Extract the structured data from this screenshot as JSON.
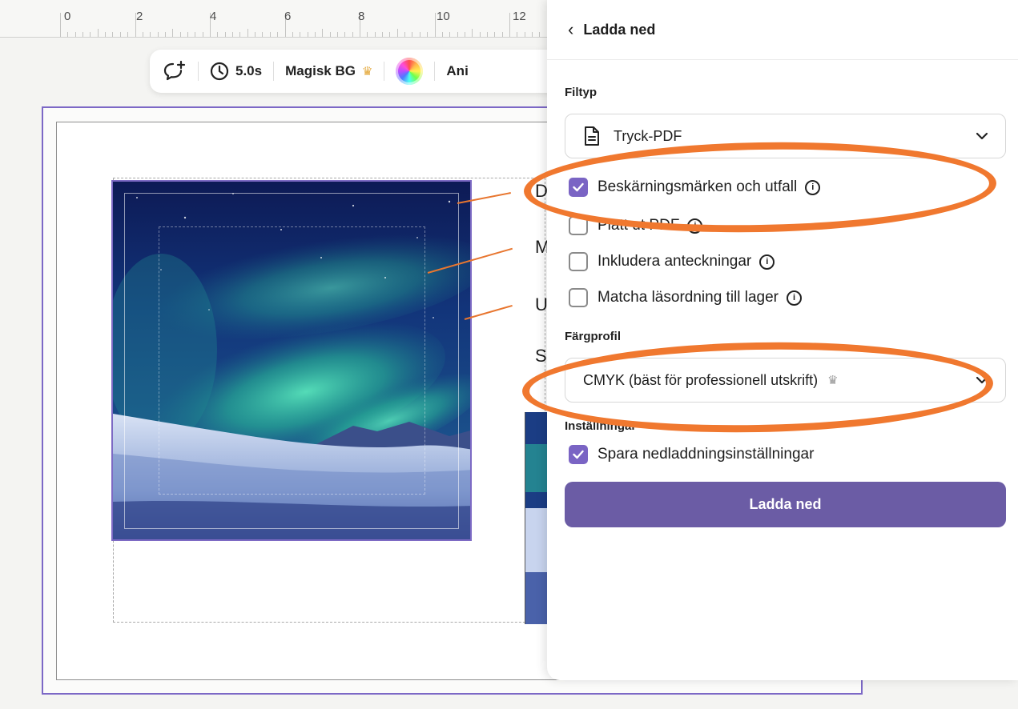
{
  "ruler": {
    "numbers": [
      "0",
      "2",
      "4",
      "6",
      "8",
      "10",
      "12"
    ]
  },
  "toolbar": {
    "duration": "5.0s",
    "magic_bg": "Magisk BG",
    "animate_partial": "Ani"
  },
  "canvas": {
    "letters": [
      "D",
      "M",
      "U",
      "S"
    ]
  },
  "panel": {
    "title": "Ladda ned",
    "filetype_label": "Filtyp",
    "filetype_value": "Tryck-PDF",
    "options": [
      {
        "label": "Beskärningsmärken och utfall",
        "checked": true,
        "info": true
      },
      {
        "label": "Platt ut PDF",
        "checked": false,
        "info": true
      },
      {
        "label": "Inkludera anteckningar",
        "checked": false,
        "info": true
      },
      {
        "label": "Matcha läsordning till lager",
        "checked": false,
        "info": true
      }
    ],
    "color_profile_label": "Färgprofil",
    "color_profile_value": "CMYK (bäst för professionell utskrift)",
    "settings_label": "Inställningar",
    "save_settings_label": "Spara nedladdningsinställningar",
    "save_settings_checked": true,
    "download_button": "Ladda ned"
  },
  "colors": {
    "accent_purple": "#7a64c4",
    "button_purple": "#6b5ca5",
    "annotation_orange": "#f0782f",
    "crown_gold": "#e4a93c"
  },
  "icons": {
    "back": "chevron-left-icon",
    "dropdown": "chevron-down-icon",
    "file": "document-icon",
    "info": "info-icon",
    "crown": "crown-icon",
    "clock": "clock-icon",
    "comment": "comment-add-icon"
  }
}
